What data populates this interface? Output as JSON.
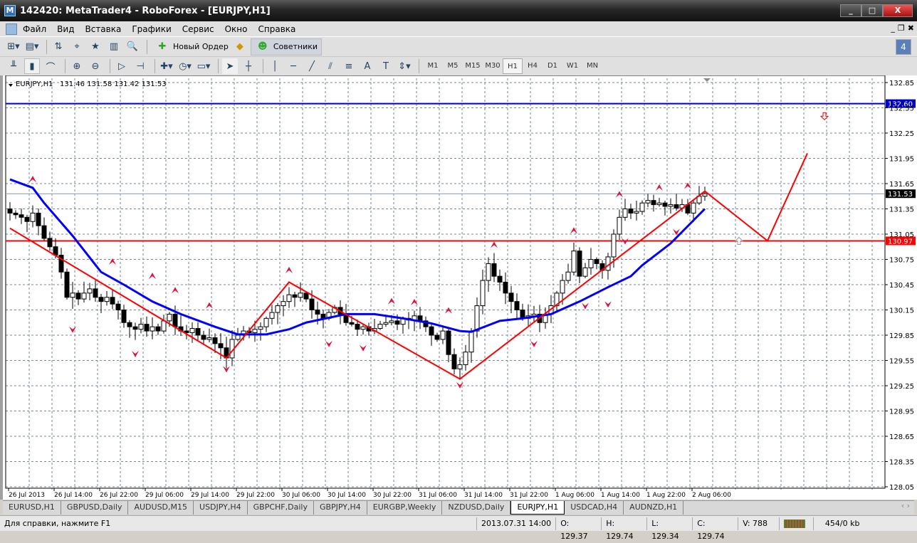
{
  "window": {
    "title": "142420: MetaTrader4 - RoboForex - [EURJPY,H1]",
    "min": "_",
    "max": "□",
    "close": "X"
  },
  "menu": [
    "Файл",
    "Вид",
    "Вставка",
    "Графики",
    "Сервис",
    "Окно",
    "Справка"
  ],
  "toolbar": {
    "new_order": "Новый Ордер",
    "experts": "Советники",
    "notifications": "4"
  },
  "timeframes": [
    "M1",
    "M5",
    "M15",
    "M30",
    "H1",
    "H4",
    "D1",
    "W1",
    "MN"
  ],
  "active_timeframe": "H1",
  "chart_info": {
    "symbol": "EURJPY,H1",
    "open": "131.46",
    "high": "131.58",
    "low": "131.42",
    "close": "131.53"
  },
  "colors": {
    "bull": "#ffffff",
    "bear": "#000000",
    "ma": "#0000ff",
    "zigzag": "#ff0000",
    "fractal": "#dc143c",
    "grid": "#778899"
  },
  "chart_data": {
    "type": "candlestick",
    "ylim": [
      128.05,
      132.85
    ],
    "y_ticks": [
      "132.85",
      "132.55",
      "132.25",
      "131.95",
      "131.65",
      "131.35",
      "131.05",
      "130.75",
      "130.45",
      "130.15",
      "129.85",
      "129.55",
      "129.25",
      "128.95",
      "128.65",
      "128.35",
      "128.05"
    ],
    "x_labels": [
      "26 Jul 2013",
      "26 Jul 14:00",
      "26 Jul 22:00",
      "29 Jul 06:00",
      "29 Jul 14:00",
      "29 Jul 22:00",
      "30 Jul 06:00",
      "30 Jul 14:00",
      "30 Jul 22:00",
      "31 Jul 06:00",
      "31 Jul 14:00",
      "31 Jul 22:00",
      "1 Aug 06:00",
      "1 Aug 14:00",
      "1 Aug 22:00",
      "2 Aug 06:00"
    ],
    "closes": [
      131.3,
      131.28,
      131.25,
      131.2,
      131.3,
      131.15,
      131.0,
      130.9,
      130.8,
      130.6,
      130.3,
      130.35,
      130.28,
      130.35,
      130.4,
      130.3,
      130.25,
      130.3,
      130.22,
      130.15,
      130.0,
      129.95,
      129.92,
      129.98,
      129.9,
      129.95,
      129.9,
      130.02,
      130.1,
      129.95,
      129.9,
      129.88,
      129.93,
      129.85,
      129.8,
      129.82,
      129.75,
      129.7,
      129.58,
      129.8,
      129.85,
      129.9,
      129.88,
      129.92,
      129.95,
      130.05,
      130.12,
      130.2,
      130.25,
      130.33,
      130.3,
      130.35,
      130.28,
      130.15,
      130.1,
      130.05,
      130.12,
      130.18,
      130.1,
      130.0,
      129.98,
      129.92,
      129.95,
      129.9,
      129.93,
      129.98,
      130.0,
      130.02,
      129.98,
      130.05,
      130.03,
      130.08,
      130.02,
      129.95,
      129.85,
      129.8,
      129.9,
      129.62,
      129.45,
      129.5,
      129.65,
      129.9,
      130.2,
      130.5,
      130.7,
      130.55,
      130.48,
      130.35,
      130.25,
      130.15,
      130.05,
      130.08,
      130.1,
      130.0,
      130.1,
      130.2,
      130.35,
      130.5,
      130.6,
      130.85,
      130.55,
      130.65,
      130.75,
      130.7,
      130.62,
      130.78,
      131.05,
      131.25,
      131.35,
      131.3,
      131.32,
      131.42,
      131.45,
      131.4,
      131.42,
      131.38,
      131.4,
      131.36,
      131.4,
      131.3,
      131.42,
      131.5,
      131.53
    ],
    "ma": [
      [
        0,
        131.7
      ],
      [
        4,
        131.6
      ],
      [
        6,
        131.42
      ],
      [
        11,
        131.03
      ],
      [
        16,
        130.6
      ],
      [
        20,
        130.45
      ],
      [
        25,
        130.25
      ],
      [
        30,
        130.1
      ],
      [
        36,
        129.95
      ],
      [
        40,
        129.86
      ],
      [
        45,
        129.86
      ],
      [
        49,
        129.92
      ],
      [
        52,
        130.0
      ],
      [
        59,
        130.1
      ],
      [
        64,
        130.1
      ],
      [
        69,
        130.05
      ],
      [
        74,
        129.99
      ],
      [
        79,
        129.9
      ],
      [
        81,
        129.89
      ],
      [
        86,
        130.02
      ],
      [
        90,
        130.05
      ],
      [
        95,
        130.1
      ],
      [
        100,
        130.25
      ],
      [
        105,
        130.42
      ],
      [
        109,
        130.55
      ],
      [
        111,
        130.68
      ],
      [
        116,
        130.94
      ],
      [
        122,
        131.35
      ]
    ],
    "zigzag": [
      [
        0,
        131.12
      ],
      [
        38,
        129.58
      ],
      [
        49,
        130.48
      ],
      [
        79,
        129.33
      ],
      [
        122,
        131.56
      ],
      [
        133,
        130.97
      ],
      [
        140,
        132.01
      ]
    ],
    "fractals_up": [
      [
        4,
        131.7
      ],
      [
        18,
        130.72
      ],
      [
        25,
        130.55
      ],
      [
        29,
        130.38
      ],
      [
        35,
        130.2
      ],
      [
        49,
        130.62
      ],
      [
        67,
        130.25
      ],
      [
        71,
        130.24
      ],
      [
        77,
        130.14
      ],
      [
        85,
        130.92
      ],
      [
        99,
        131.09
      ],
      [
        107,
        131.52
      ],
      [
        114,
        131.6
      ],
      [
        119,
        131.62
      ]
    ],
    "fractals_down": [
      [
        11,
        129.92
      ],
      [
        22,
        129.63
      ],
      [
        38,
        129.45
      ],
      [
        56,
        129.75
      ],
      [
        62,
        129.7
      ],
      [
        79,
        129.26
      ],
      [
        92,
        129.75
      ],
      [
        101,
        130.2
      ],
      [
        105,
        130.22
      ],
      [
        108,
        130.97
      ],
      [
        117,
        131.08
      ]
    ],
    "hlines": [
      {
        "price": 132.6,
        "label": "132.60",
        "color": "#0000cc"
      },
      {
        "price": 130.97,
        "label": "130.97",
        "color": "#ff0000"
      },
      {
        "price": 131.53,
        "label": "131.53",
        "color": "#000000"
      }
    ],
    "arrows": [
      {
        "dir": "down",
        "bar": 143,
        "price": 132.45,
        "color": "#ff0000"
      },
      {
        "dir": "up",
        "bar": 128,
        "price": 130.97,
        "color": "#999999"
      }
    ]
  },
  "tabs": [
    "EURUSD,H1",
    "GBPUSD,Daily",
    "AUDUSD,M15",
    "USDJPY,H4",
    "GBPCHF,Daily",
    "GBPJPY,H4",
    "EURGBP,Weekly",
    "NZDUSD,Daily",
    "EURJPY,H1",
    "USDCAD,H4",
    "AUDNZD,H1"
  ],
  "active_tab": "EURJPY,H1",
  "status": {
    "help": "Для справки, нажмите F1",
    "time": "2013.07.31 14:00",
    "o": "O: 129.37",
    "h": "H: 129.74",
    "l": "L: 129.34",
    "c": "C: 129.74",
    "v": "V: 788",
    "traffic": "454/0 kb"
  }
}
